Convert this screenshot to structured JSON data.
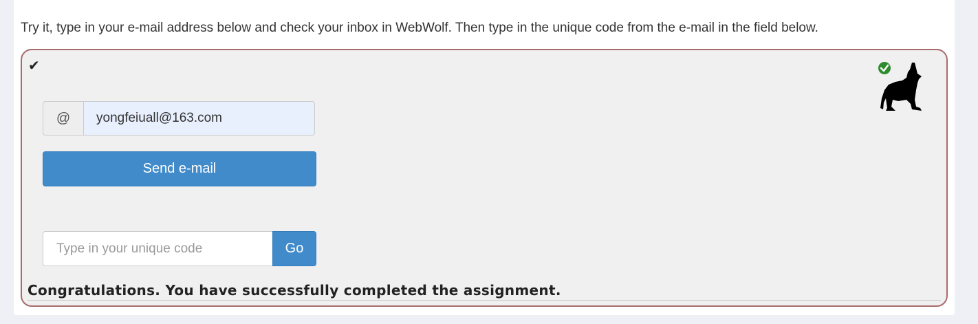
{
  "instructions": "Try it, type in your e-mail address below and check your inbox in WebWolf. Then type in the unique code from the e-mail in the field below.",
  "assignment": {
    "status_icon": "check-icon",
    "badge_icon": "webwolf-solved-icon",
    "email": {
      "addon_label": "@",
      "value": "yongfeiuall@163.com"
    },
    "send_button_label": "Send e-mail",
    "code": {
      "placeholder": "Type in your unique code",
      "value": ""
    },
    "go_button_label": "Go",
    "feedback": "Congratulations. You have successfully completed the assignment."
  },
  "colors": {
    "primary_button": "#428bca",
    "assignment_border": "#a86a6a",
    "assignment_bg": "#f0f0f0",
    "success_green": "#2e8b2e"
  }
}
